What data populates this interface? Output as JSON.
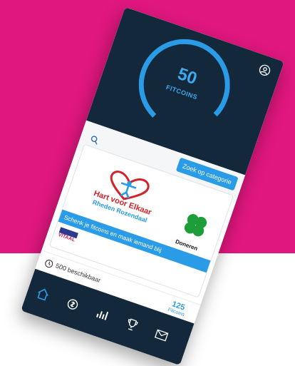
{
  "colors": {
    "background_top": "#E0177E",
    "background_bottom": "#ffffff",
    "panel_dark": "#13293B",
    "accent_blue": "#2A9BE6",
    "logo_red": "#D3232A"
  },
  "header": {
    "coins_value": "50",
    "coins_label": "FITCOINS",
    "profile_icon": "profile-icon"
  },
  "search": {
    "icon": "search-icon",
    "category_button_label": "Zoek op categorie"
  },
  "card": {
    "logo_title": "Hart voor Elkaar",
    "logo_subtitle": "Rheden Rozendaal",
    "donate_label": "Doneren",
    "donate_icon": "clover-icon",
    "banner_text": "Schenk je fitcoins en maak iemand blij",
    "partner_logo_text": "VITAAL"
  },
  "availability": {
    "icon": "clock-icon",
    "text": "500 beschikbaar",
    "tag_icon": "ticket-icon"
  },
  "fitcoins_tab": {
    "count": "125",
    "label": "Fitcoins"
  },
  "bottom_nav": {
    "items": [
      {
        "icon": "home-icon"
      },
      {
        "icon": "coins-icon"
      },
      {
        "icon": "stats-icon"
      },
      {
        "icon": "trophy-icon"
      },
      {
        "icon": "mail-icon"
      }
    ]
  }
}
